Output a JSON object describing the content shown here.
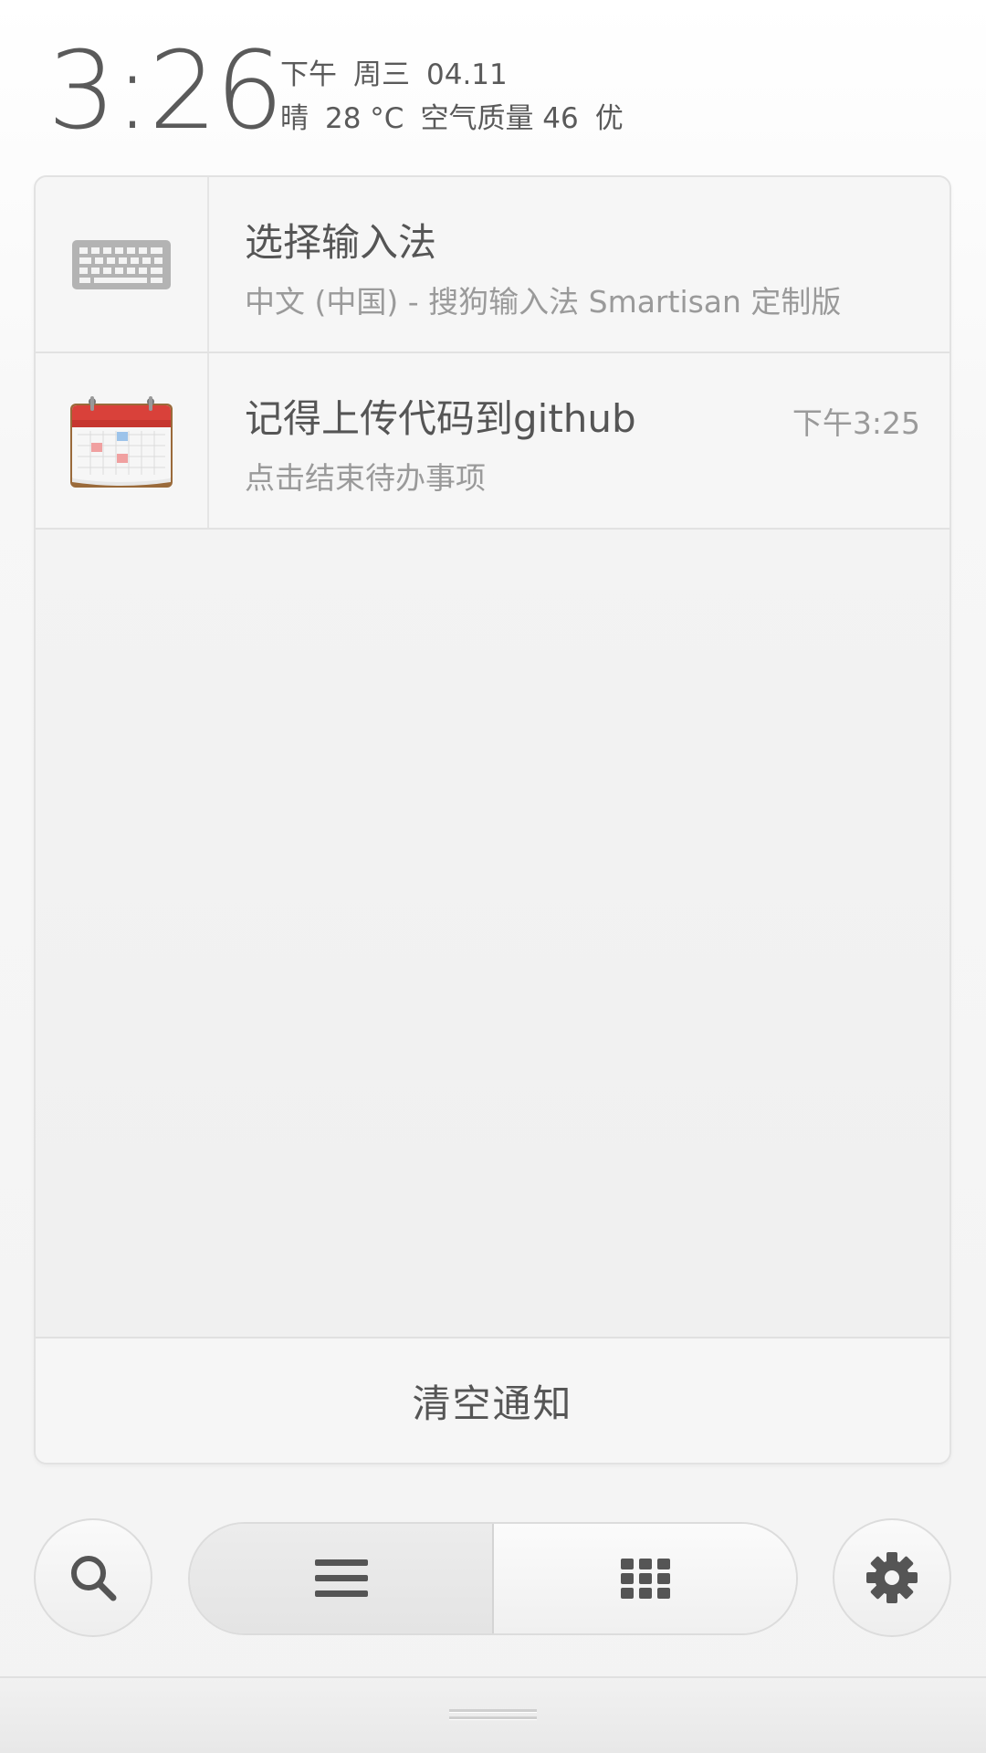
{
  "header": {
    "time": "3:26",
    "period": "下午",
    "weekday": "周三",
    "date": "04.11",
    "weather": "晴",
    "temperature": "28 °C",
    "air_quality_label": "空气质量 46",
    "air_quality_level": "优"
  },
  "notifications": [
    {
      "icon": "keyboard-icon",
      "title": "选择输入法",
      "subtitle": "中文 (中国) - 搜狗输入法 Smartisan 定制版"
    },
    {
      "icon": "calendar-icon",
      "title": "记得上传代码到github",
      "subtitle": "点击结束待办事项",
      "time": "下午3:25"
    }
  ],
  "actions": {
    "clear_label": "清空通知"
  },
  "controls": {
    "left": "search-icon",
    "seg_left": "list-icon",
    "seg_right": "grid-icon",
    "right": "gear-icon"
  },
  "colors": {
    "text": "#555555",
    "subtext": "#9a9a9a",
    "calendar_red": "#d9413a"
  }
}
